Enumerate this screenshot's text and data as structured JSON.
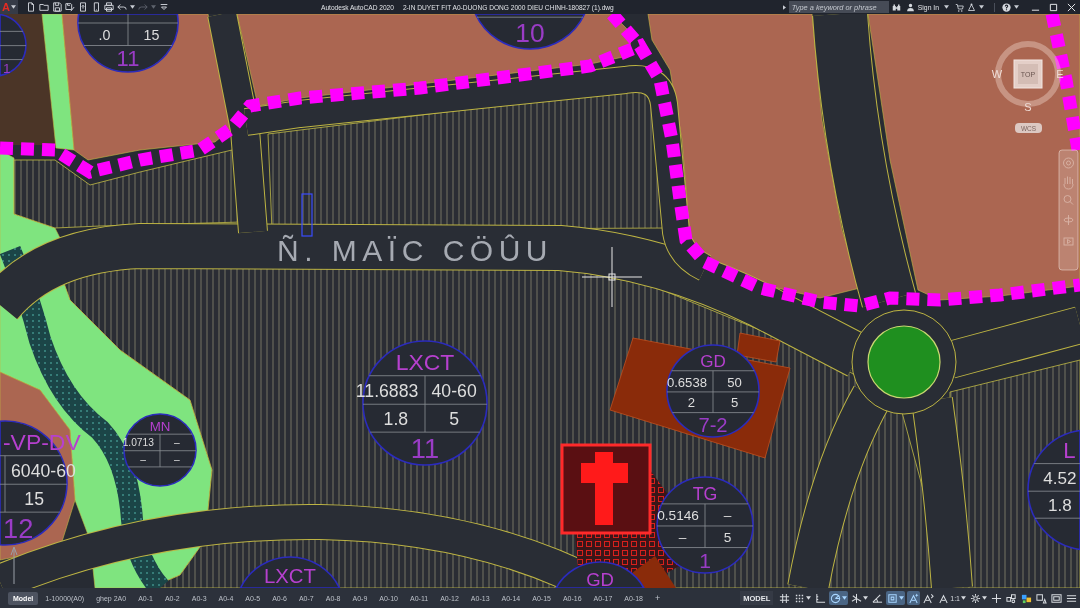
{
  "title_bar": {
    "app_button": "A",
    "quick_access": [
      {
        "kind": "new",
        "disabled": false
      },
      {
        "kind": "open",
        "disabled": false
      },
      {
        "kind": "save",
        "disabled": false
      },
      {
        "kind": "save_as",
        "disabled": false
      },
      {
        "kind": "web_open",
        "disabled": false
      },
      {
        "kind": "web_save",
        "disabled": false
      },
      {
        "kind": "plot",
        "disabled": false
      },
      {
        "kind": "undo",
        "disabled": false
      },
      {
        "kind": "redo",
        "disabled": true
      },
      {
        "kind": "customize",
        "disabled": false
      }
    ],
    "app_name": "Autodesk AutoCAD 2020",
    "file_name": "2-IN DUYET FIT A0-DUONG DONG 2000 DIEU CHINH-180827 (1).dwg",
    "search": {
      "placeholder": "Type a keyword or phrase"
    },
    "sign_in": "Sign In"
  },
  "drawing": {
    "street_name": "Ñ. MAÏC CÖÛU",
    "lot_tags": [
      {
        "row_2": [
          ".0",
          "15"
        ],
        "number": "11"
      },
      {
        "number": "10"
      },
      {
        "number": "1"
      },
      {
        "code": "LXCT",
        "row_1": [
          "11.6883",
          "40-60"
        ],
        "row_2": [
          "1.8",
          "5"
        ],
        "number": "11"
      },
      {
        "code": "GD",
        "row_1": [
          "0.6538",
          "50"
        ],
        "row_2": [
          "2",
          "5"
        ],
        "number": "7-2"
      },
      {
        "code": "MN",
        "row_1": [
          "1.0713",
          "–"
        ],
        "row_2": [
          "–",
          "–"
        ]
      },
      {
        "code": "TG",
        "row_1": [
          "0.5146",
          "–"
        ],
        "row_2": [
          "–",
          "5"
        ],
        "number": "1"
      },
      {
        "code": "-VP-DV",
        "row_1": [
          "6040-60"
        ],
        "row_2": [
          "15"
        ],
        "number": "12"
      },
      {
        "code": "L",
        "row_1": [
          "4.52"
        ],
        "row_2": [
          "1.8"
        ]
      },
      {
        "code": "LXCT"
      },
      {
        "code": "GD"
      }
    ]
  },
  "view_cube": {
    "face": "TOP",
    "west": "W",
    "east": "E",
    "south": "S",
    "coordinate_system": "WCS"
  },
  "layouts": {
    "tabs": [
      {
        "label": "Model",
        "selected": true
      },
      {
        "label": "1-10000(A0)",
        "selected": false
      },
      {
        "label": "ghep 2A0",
        "selected": false
      },
      {
        "label": "A0-1",
        "selected": false
      },
      {
        "label": "A0-2",
        "selected": false
      },
      {
        "label": "A0-3",
        "selected": false
      },
      {
        "label": "A0-4",
        "selected": false
      },
      {
        "label": "A0-5",
        "selected": false
      },
      {
        "label": "A0-6",
        "selected": false
      },
      {
        "label": "A0-7",
        "selected": false
      },
      {
        "label": "A0-8",
        "selected": false
      },
      {
        "label": "A0-9",
        "selected": false
      },
      {
        "label": "A0-10",
        "selected": false
      },
      {
        "label": "A0-11",
        "selected": false
      },
      {
        "label": "A0-12",
        "selected": false
      },
      {
        "label": "A0-13",
        "selected": false
      },
      {
        "label": "A0-14",
        "selected": false
      },
      {
        "label": "A0-15",
        "selected": false
      },
      {
        "label": "A0-16",
        "selected": false
      },
      {
        "label": "A0-17",
        "selected": false
      },
      {
        "label": "A0-18",
        "selected": false
      }
    ],
    "add_button": "+"
  },
  "status_bar": {
    "space": "MODEL",
    "tools": [
      {
        "kind": "grid",
        "on": false,
        "menu": false
      },
      {
        "kind": "snap",
        "on": false,
        "menu": true
      },
      {
        "kind": "ortho",
        "on": false,
        "menu": false
      },
      {
        "kind": "polar",
        "on": true,
        "menu": true
      },
      {
        "kind": "isodraft",
        "on": false,
        "menu": true
      },
      {
        "kind": "tracking",
        "on": false,
        "menu": false
      },
      {
        "kind": "osnap",
        "on": true,
        "menu": true
      },
      {
        "kind": "annotation_visibility",
        "on": true,
        "menu": false
      },
      {
        "kind": "autoscale",
        "on": false,
        "menu": false
      },
      {
        "kind": "scale",
        "label": "1:1",
        "on": false,
        "menu": true
      },
      {
        "kind": "workspace",
        "on": false,
        "menu": true
      },
      {
        "kind": "monitor",
        "on": false,
        "menu": false
      },
      {
        "kind": "isolate",
        "on": false,
        "menu": false
      },
      {
        "kind": "hardware",
        "on": false,
        "menu": false
      },
      {
        "kind": "performance",
        "on": false,
        "menu": false
      },
      {
        "kind": "clean_screen",
        "on": false,
        "menu": false
      },
      {
        "kind": "customize",
        "on": false,
        "menu": false
      }
    ]
  }
}
